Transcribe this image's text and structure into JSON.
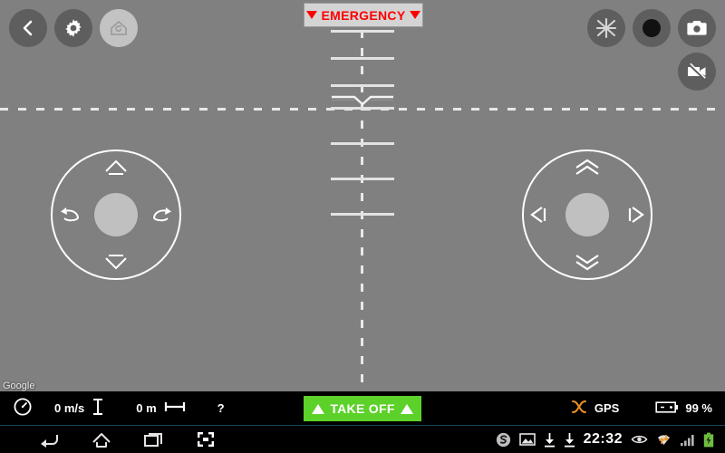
{
  "app": {
    "name": "drone-flight-control",
    "colors": {
      "background": "#808080",
      "emergency_red": "#ff0000",
      "takeoff_green": "#5cd12a",
      "status_bar": "#000000",
      "gps_orange": "#f0921e",
      "hud_white": "#fdfdfd"
    }
  },
  "top_bar": {
    "back_button": {
      "icon": "chevron-left-icon",
      "label": "Back"
    },
    "settings_button": {
      "icon": "gear-icon",
      "label": "Settings"
    },
    "home_button": {
      "icon": "return-to-home-icon",
      "label": "Return To Home",
      "active": true
    },
    "emergency_button": {
      "label": "EMERGENCY",
      "left_marker": "▼",
      "right_marker": "▼"
    },
    "drone_button": {
      "icon": "drone-propeller-icon",
      "label": "Drone"
    },
    "record_button": {
      "icon": "record-dot-icon",
      "label": "Record"
    },
    "photo_button": {
      "icon": "camera-icon",
      "label": "Take Photo"
    },
    "video_button": {
      "icon": "video-camera-off-icon",
      "label": "Video Off"
    }
  },
  "hud": {
    "horizon_label": "artificial-horizon",
    "pitch_ladder_offsets": [
      -86,
      -56,
      -26,
      38,
      75,
      112
    ],
    "aircraft_symbol": "aircraft-wings-icon"
  },
  "controls": {
    "left_joystick": {
      "name": "throttle-yaw-joystick",
      "north": {
        "icon": "arrow-up-icon",
        "label": "Ascend"
      },
      "south": {
        "icon": "arrow-down-icon",
        "label": "Descend"
      },
      "west": {
        "icon": "rotate-left-icon",
        "label": "Rotate Left"
      },
      "east": {
        "icon": "rotate-right-icon",
        "label": "Rotate Right"
      }
    },
    "right_joystick": {
      "name": "pitch-roll-joystick",
      "north": {
        "icon": "double-chevron-up-icon",
        "label": "Forward"
      },
      "south": {
        "icon": "double-chevron-down-icon",
        "label": "Backward"
      },
      "west": {
        "icon": "triangle-left-icon",
        "label": "Left"
      },
      "east": {
        "icon": "triangle-right-icon",
        "label": "Right"
      }
    }
  },
  "map": {
    "watermark": "Google"
  },
  "status_bar": {
    "speed": {
      "icon": "speedometer-icon",
      "value": "0 m/s"
    },
    "altitude": {
      "icon": "altitude-icon",
      "value": "0 m"
    },
    "distance": {
      "icon": "distance-icon",
      "value": "?"
    },
    "takeoff_button": {
      "label": "TAKE OFF",
      "left_marker": "▲",
      "right_marker": "▲"
    },
    "gps": {
      "icon": "drone-propeller-icon",
      "label": "GPS"
    },
    "battery": {
      "icon": "battery-icon",
      "value": "99 %"
    }
  },
  "system_bar": {
    "nav": [
      {
        "icon": "android-back-icon",
        "label": "Back"
      },
      {
        "icon": "android-home-icon",
        "label": "Home"
      },
      {
        "icon": "android-recents-icon",
        "label": "Recent Apps"
      },
      {
        "icon": "screenshot-icon",
        "label": "Screenshot"
      }
    ],
    "tray": [
      {
        "icon": "skype-icon",
        "label": "Skype"
      },
      {
        "icon": "image-icon",
        "label": "Screenshot Saved"
      },
      {
        "icon": "download-icon",
        "label": "Download"
      },
      {
        "icon": "download-icon",
        "label": "Download"
      }
    ],
    "clock": "22:32",
    "tray_right": [
      {
        "icon": "eye-icon",
        "label": "Smart Stay"
      },
      {
        "icon": "wifi-icon",
        "label": "Wi-Fi"
      },
      {
        "icon": "signal-icon",
        "label": "Signal"
      },
      {
        "icon": "battery-charging-icon",
        "label": "Battery Charging"
      }
    ]
  }
}
